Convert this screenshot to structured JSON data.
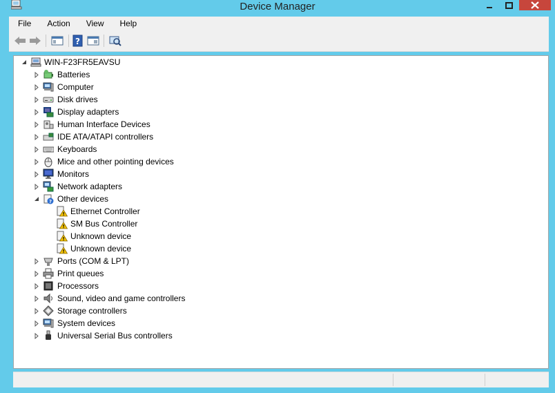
{
  "window": {
    "title": "Device Manager",
    "accent_color": "#63cbea",
    "close_color": "#c7463c"
  },
  "menu": [
    "File",
    "Action",
    "View",
    "Help"
  ],
  "toolbar": {
    "buttons": [
      "back-arrow-icon",
      "forward-arrow-icon",
      "show-hide-console-tree-icon",
      "help-icon",
      "properties-pane-icon",
      "scan-hardware-icon"
    ]
  },
  "tree": {
    "root": "WIN-F23FR5EAVSU",
    "categories": [
      {
        "label": "Batteries",
        "icon": "battery-icon",
        "expanded": false
      },
      {
        "label": "Computer",
        "icon": "computer-icon",
        "expanded": false
      },
      {
        "label": "Disk drives",
        "icon": "disk-drive-icon",
        "expanded": false
      },
      {
        "label": "Display adapters",
        "icon": "display-adapter-icon",
        "expanded": false
      },
      {
        "label": "Human Interface Devices",
        "icon": "hid-icon",
        "expanded": false
      },
      {
        "label": "IDE ATA/ATAPI controllers",
        "icon": "ide-controller-icon",
        "expanded": false
      },
      {
        "label": "Keyboards",
        "icon": "keyboard-icon",
        "expanded": false
      },
      {
        "label": "Mice and other pointing devices",
        "icon": "mouse-icon",
        "expanded": false
      },
      {
        "label": "Monitors",
        "icon": "monitor-icon",
        "expanded": false
      },
      {
        "label": "Network adapters",
        "icon": "network-adapter-icon",
        "expanded": false
      },
      {
        "label": "Other devices",
        "icon": "unknown-device-icon",
        "expanded": true,
        "children": [
          "Ethernet Controller",
          "SM Bus Controller",
          "Unknown device",
          "Unknown device"
        ]
      },
      {
        "label": "Ports (COM & LPT)",
        "icon": "port-icon",
        "expanded": false
      },
      {
        "label": "Print queues",
        "icon": "printer-icon",
        "expanded": false
      },
      {
        "label": "Processors",
        "icon": "processor-icon",
        "expanded": false
      },
      {
        "label": "Sound, video and game controllers",
        "icon": "speaker-icon",
        "expanded": false
      },
      {
        "label": "Storage controllers",
        "icon": "storage-controller-icon",
        "expanded": false
      },
      {
        "label": "System devices",
        "icon": "system-devices-icon",
        "expanded": false
      },
      {
        "label": "Universal Serial Bus controllers",
        "icon": "usb-icon",
        "expanded": false
      }
    ]
  }
}
